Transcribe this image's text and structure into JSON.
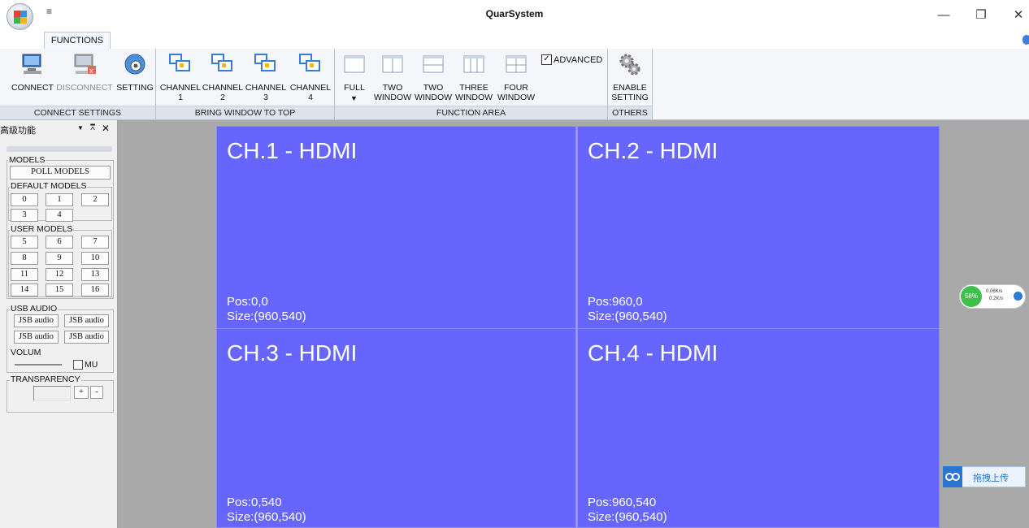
{
  "app": {
    "title": "QuarSystem",
    "qat_glyph": "≡"
  },
  "window_controls": {
    "minimize": "—",
    "restore": "❐",
    "close": "✕"
  },
  "tabs": [
    {
      "label": "FUNCTIONS"
    }
  ],
  "ribbon": {
    "connect_settings": {
      "label": "CONNECT SETTINGS",
      "buttons": {
        "connect": "CONNECT",
        "disconnect": "DISCONNECT",
        "setting": "SETTING"
      }
    },
    "bring_window": {
      "label": "BRING WINDOW TO TOP",
      "buttons": [
        {
          "line1": "CHANNEL",
          "line2": "1"
        },
        {
          "line1": "CHANNEL",
          "line2": "2"
        },
        {
          "line1": "CHANNEL",
          "line2": "3"
        },
        {
          "line1": "CHANNEL",
          "line2": "4"
        }
      ]
    },
    "function_area": {
      "label": "FUNCTION AREA",
      "advanced_label": "ADVANCED",
      "advanced_checked": true,
      "dropdown_glyph": "▼",
      "buttons": [
        {
          "line1": "FULL",
          "line2": ""
        },
        {
          "line1": "TWO",
          "line2": "WINDOW"
        },
        {
          "line1": "TWO",
          "line2": "WINDOW"
        },
        {
          "line1": "THREE",
          "line2": "WINDOW"
        },
        {
          "line1": "FOUR",
          "line2": "WINDOW"
        }
      ]
    },
    "others": {
      "label": "OTHERS",
      "enable_line1": "ENABLE",
      "enable_line2": "SETTING"
    }
  },
  "panel": {
    "title": "高级功能",
    "title_controls": {
      "dropdown": "▼",
      "pin": "⩞",
      "close": "✕"
    },
    "models_legend": "MODELS",
    "poll_models": "POLL MODELS",
    "default_models_legend": "DEFAULT MODELS",
    "default_models": [
      "0",
      "1",
      "2",
      "3",
      "4"
    ],
    "user_models_legend": "USER MODELS",
    "user_models": [
      "5",
      "6",
      "7",
      "8",
      "9",
      "10",
      "11",
      "12",
      "13",
      "14",
      "15",
      "16"
    ],
    "usb_audio_legend": "USB AUDIO",
    "usb_audio_buttons": [
      "JSB audio",
      "JSB audio",
      "JSB audio",
      "JSB audio"
    ],
    "volume_label": "VOLUM",
    "mute_label": "MU",
    "transparency_legend": "TRANSPARENCY",
    "plus": "+",
    "minus": "-"
  },
  "channels": [
    {
      "title": "CH.1 - HDMI",
      "pos": "Pos:0,0",
      "size": "Size:(960,540)"
    },
    {
      "title": "CH.2 - HDMI",
      "pos": "Pos:960,0",
      "size": "Size:(960,540)"
    },
    {
      "title": "CH.3 - HDMI",
      "pos": "Pos:0,540",
      "size": "Size:(960,540)"
    },
    {
      "title": "CH.4 - HDMI",
      "pos": "Pos:960,540",
      "size": "Size:(960,540)"
    }
  ],
  "widgets": {
    "speed_percent": "58%",
    "speed_up": "0.06K/s",
    "speed_down": "0.2K/s",
    "upload_label": "拖拽上传"
  },
  "colors": {
    "channel_bg": "#6666ff",
    "canvas_bg": "#a9a9a9",
    "accent": "#3f7fd9"
  }
}
